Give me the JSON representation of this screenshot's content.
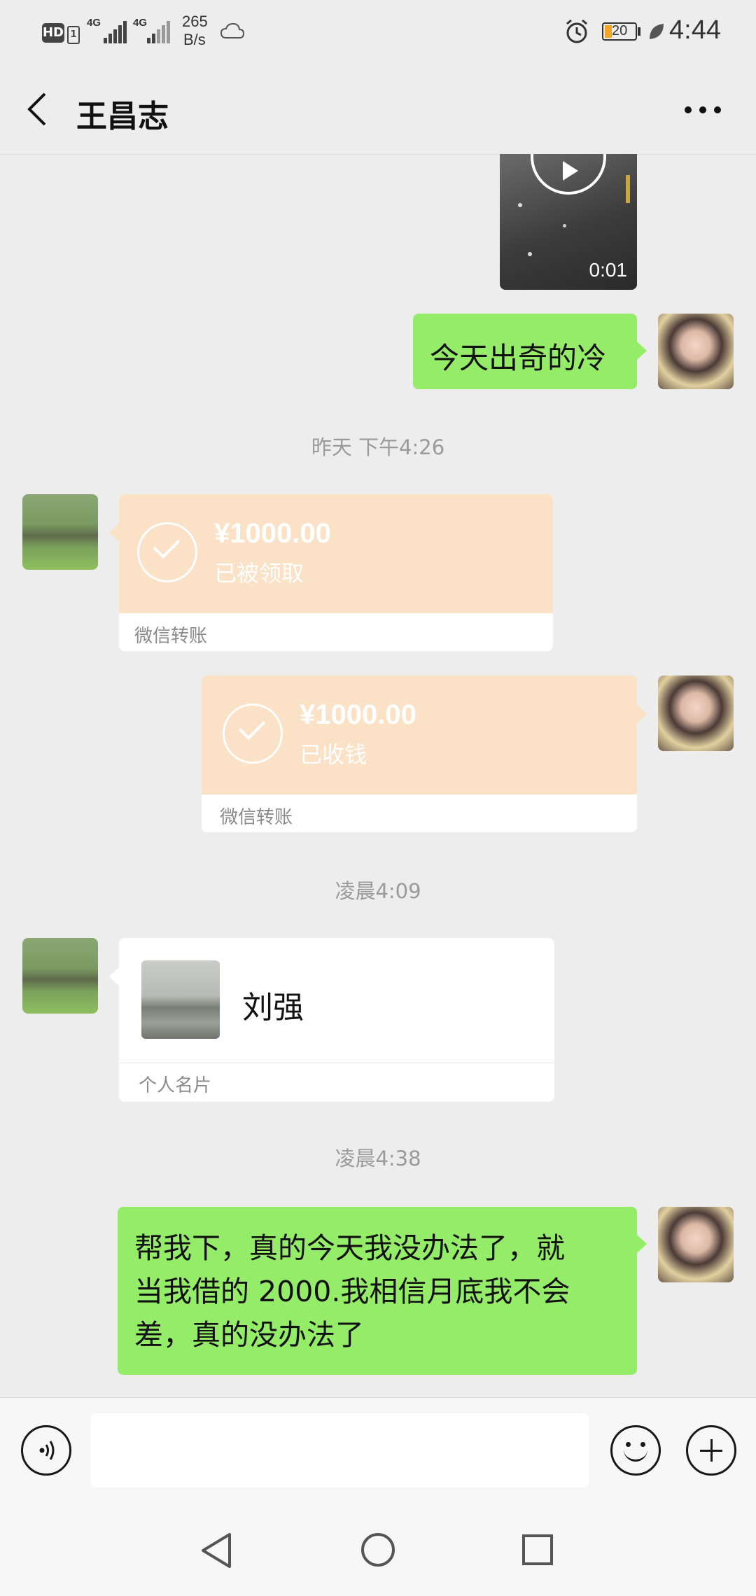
{
  "status_bar": {
    "hd": "HD",
    "sim": "1",
    "net1": "4G",
    "net2": "4G",
    "speed_value": "265",
    "speed_unit": "B/s",
    "battery": "20",
    "time": "4:44",
    "icons": [
      "alarm-icon",
      "battery-icon",
      "leaf-icon",
      "cloud-icon"
    ]
  },
  "header": {
    "back_icon": "back-icon",
    "title": "王昌志",
    "more_icon": "more-icon"
  },
  "messages": {
    "video": {
      "duration": "0:01"
    },
    "cold": {
      "text": "今天出奇的冷"
    },
    "ts1": "昨天 下午4:26",
    "transfer_in": {
      "amount": "¥1000.00",
      "status": "已被领取",
      "footer": "微信转账"
    },
    "transfer_out": {
      "amount": "¥1000.00",
      "status": "已收钱",
      "footer": "微信转账"
    },
    "ts2": "凌晨4:09",
    "card": {
      "name": "刘强",
      "footer": "个人名片"
    },
    "ts3": "凌晨4:38",
    "last": {
      "line1": "帮我下，真的今天我没办法了，就",
      "line2": "当我借的 2000.我相信月底我不会",
      "line3": "差，真的没办法了"
    }
  },
  "input_bar": {
    "voice_icon": "voice-icon",
    "emoji_icon": "emoji-icon",
    "plus_icon": "plus-icon",
    "placeholder": ""
  },
  "nav_bar": {
    "icons": [
      "back-triangle-icon",
      "home-circle-icon",
      "recents-square-icon"
    ]
  },
  "colors": {
    "background": "#ededed",
    "green_bubble": "#95ec69",
    "transfer": "#fbe1c5"
  }
}
